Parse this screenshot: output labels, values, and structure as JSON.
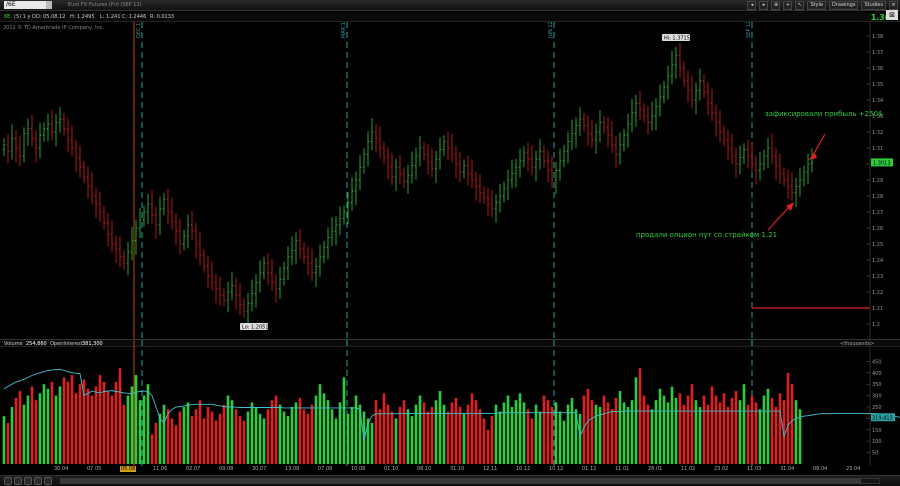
{
  "toolbar": {
    "symbol": "/6E",
    "description": "Euro FX Futures (Fri) (SEP 12)",
    "buttons": [
      "Style",
      "Drawings",
      "Studies"
    ],
    "last_price": "1.301",
    "minmax_icon": "minimize-icon"
  },
  "infobar": {
    "symbol": "6E",
    "period": "(5) 1 y D",
    "date": "D: 05.08.12",
    "high": "H: 1.2495",
    "low": "L: 1.241",
    "close": "C: 1.2446",
    "range": "R: 0.0133"
  },
  "copyright": "2012 © TD Ameritrade IP Company, Inc.",
  "annotations": {
    "profit": "зафиксировали прибыль +250$",
    "sold_put": "продали опцион пут со страйком 1.21"
  },
  "price_labels": {
    "high": "Hi: 1.3715",
    "low": "Lo: 1.2051",
    "current": "1.3013"
  },
  "volume_header": {
    "volume_label": "Volume",
    "volume_value": "254,860",
    "oi_label": "OpenInterest",
    "oi_value": "381,300",
    "units": "<thousands>",
    "oi_current": "319,413"
  },
  "colors": {
    "up": "#2ecc40",
    "down": "#e02020",
    "oi_line": "#40c0d0",
    "divider": "#2aa0a0",
    "strike_line": "#e02020",
    "annotation": "#2ecc40"
  },
  "chart_data": {
    "type": "candlestick",
    "price_axis": {
      "ylim": [
        1.195,
        1.385
      ],
      "ticks": [
        "1.38",
        "1.37",
        "1.36",
        "1.35",
        "1.34",
        "1.33",
        "1.32",
        "1.31",
        "1.3",
        "1.29",
        "1.28",
        "1.27",
        "1.26",
        "1.25",
        "1.24",
        "1.23",
        "1.22",
        "1.21",
        "1.2"
      ]
    },
    "volume_axis": {
      "ylim": [
        0,
        500
      ],
      "ticks": [
        "450",
        "400",
        "350",
        "300",
        "250",
        "200",
        "150",
        "100",
        "50"
      ]
    },
    "period_labels": [
      "DEC 11",
      "MAR 12",
      "JUN 12",
      "SEP 12"
    ],
    "strike_level": 1.21,
    "time_labels": [
      "30.04",
      "07.05",
      "05.08",
      "11.06",
      "02.07",
      "09.08",
      "30.07",
      "13.08",
      "07.08",
      "10.08",
      "01.10",
      "08.10",
      "31.10",
      "12.11",
      "10.12",
      "10.12",
      "01.12",
      "11.01",
      "28.01",
      "11.02",
      "23.02",
      "11.03",
      "31.04",
      "08.04",
      "23.04"
    ],
    "highlighted_time_label": "05.08",
    "closes": [
      1.312,
      1.308,
      1.316,
      1.31,
      1.305,
      1.319,
      1.322,
      1.316,
      1.31,
      1.318,
      1.322,
      1.325,
      1.32,
      1.326,
      1.328,
      1.322,
      1.315,
      1.31,
      1.304,
      1.298,
      1.292,
      1.286,
      1.28,
      1.275,
      1.27,
      1.263,
      1.256,
      1.25,
      1.247,
      1.242,
      1.238,
      1.245,
      1.252,
      1.26,
      1.265,
      1.27,
      1.275,
      1.268,
      1.262,
      1.272,
      1.278,
      1.27,
      1.264,
      1.258,
      1.25,
      1.255,
      1.262,
      1.258,
      1.25,
      1.243,
      1.236,
      1.23,
      1.226,
      1.222,
      1.218,
      1.215,
      1.22,
      1.224,
      1.218,
      1.212,
      1.208,
      1.213,
      1.219,
      1.226,
      1.232,
      1.238,
      1.232,
      1.226,
      1.222,
      1.228,
      1.235,
      1.242,
      1.246,
      1.252,
      1.247,
      1.242,
      1.238,
      1.232,
      1.236,
      1.242,
      1.248,
      1.254,
      1.258,
      1.262,
      1.266,
      1.27,
      1.276,
      1.283,
      1.29,
      1.298,
      1.306,
      1.314,
      1.32,
      1.316,
      1.31,
      1.304,
      1.298,
      1.292,
      1.298,
      1.294,
      1.289,
      1.293,
      1.299,
      1.305,
      1.31,
      1.306,
      1.301,
      1.297,
      1.303,
      1.309,
      1.314,
      1.31,
      1.306,
      1.3,
      1.295,
      1.299,
      1.294,
      1.29,
      1.286,
      1.282,
      1.279,
      1.275,
      1.272,
      1.276,
      1.28,
      1.285,
      1.29,
      1.294,
      1.298,
      1.302,
      1.307,
      1.303,
      1.298,
      1.303,
      1.308,
      1.302,
      1.296,
      1.29,
      1.296,
      1.302,
      1.308,
      1.314,
      1.319,
      1.324,
      1.328,
      1.324,
      1.319,
      1.315,
      1.32,
      1.326,
      1.323,
      1.318,
      1.312,
      1.306,
      1.312,
      1.318,
      1.325,
      1.332,
      1.338,
      1.334,
      1.33,
      1.326,
      1.33,
      1.336,
      1.342,
      1.348,
      1.355,
      1.362,
      1.368,
      1.36,
      1.352,
      1.346,
      1.34,
      1.346,
      1.352,
      1.345,
      1.338,
      1.332,
      1.326,
      1.32,
      1.315,
      1.31,
      1.305,
      1.3,
      1.304,
      1.309,
      1.305,
      1.3,
      1.296,
      1.3,
      1.305,
      1.31,
      1.305,
      1.299,
      1.294,
      1.29,
      1.286,
      1.282,
      1.286,
      1.29,
      1.295,
      1.3,
      1.301
    ],
    "volumes": [
      210,
      180,
      250,
      290,
      320,
      260,
      300,
      340,
      280,
      310,
      350,
      330,
      360,
      300,
      340,
      380,
      360,
      390,
      310,
      350,
      370,
      330,
      300,
      340,
      390,
      360,
      320,
      300,
      360,
      420,
      260,
      300,
      340,
      390,
      280,
      300,
      350,
      130,
      180,
      220,
      260,
      240,
      200,
      170,
      230,
      250,
      270,
      210,
      240,
      280,
      200,
      250,
      230,
      190,
      220,
      260,
      300,
      280,
      240,
      210,
      190,
      230,
      270,
      250,
      220,
      200,
      240,
      280,
      300,
      260,
      230,
      210,
      250,
      270,
      290,
      240,
      220,
      260,
      300,
      350,
      310,
      280,
      240,
      200,
      270,
      380,
      220,
      250,
      300,
      260,
      230,
      200,
      180,
      280,
      240,
      310,
      260,
      230,
      200,
      250,
      280,
      240,
      210,
      260,
      300,
      270,
      230,
      250,
      280,
      320,
      260,
      230,
      270,
      290,
      250,
      220,
      260,
      310,
      280,
      240,
      200,
      150,
      210,
      260,
      230,
      270,
      300,
      250,
      280,
      310,
      270,
      240,
      200,
      260,
      230,
      300,
      280,
      250,
      270,
      230,
      190,
      260,
      290,
      240,
      220,
      300,
      330,
      280,
      260,
      250,
      300,
      270,
      240,
      290,
      320,
      270,
      250,
      280,
      380,
      420,
      300,
      260,
      240,
      280,
      330,
      300,
      270,
      340,
      290,
      310,
      260,
      300,
      350,
      280,
      250,
      300,
      260,
      340,
      300,
      270,
      310,
      250,
      290,
      320,
      280,
      350,
      260,
      300,
      270,
      240,
      300,
      330,
      290,
      250,
      310,
      280,
      400,
      350,
      280,
      240
    ],
    "open_interest": [
      330,
      340,
      350,
      360,
      365,
      372,
      380,
      388,
      395,
      400,
      405,
      410,
      412,
      414,
      416,
      410,
      405,
      400,
      398,
      396,
      300,
      310,
      320,
      315,
      312,
      318,
      320,
      322,
      318,
      316,
      312,
      310,
      308,
      315,
      318,
      320,
      316,
      300,
      250,
      200,
      180,
      220,
      240,
      250,
      252,
      255,
      258,
      260,
      262,
      262,
      262,
      262,
      262,
      258,
      255,
      252,
      250,
      250,
      249,
      248,
      248,
      248,
      248,
      248,
      248,
      248,
      248,
      248,
      248,
      248,
      246,
      246,
      246,
      246,
      246,
      246,
      246,
      246,
      246,
      246,
      246,
      246,
      246,
      246,
      246,
      246,
      246,
      246,
      246,
      240,
      100,
      180,
      210,
      220,
      220,
      220,
      220,
      220,
      220,
      222,
      222,
      222,
      222,
      222,
      222,
      222,
      222,
      222,
      222,
      222,
      222,
      222,
      222,
      222,
      222,
      222,
      222,
      222,
      222,
      222,
      222,
      222,
      222,
      222,
      225,
      225,
      225,
      225,
      225,
      225,
      225,
      225,
      225,
      225,
      225,
      225,
      225,
      225,
      225,
      225,
      225,
      225,
      225,
      225,
      120,
      160,
      190,
      200,
      210,
      215,
      220,
      225,
      230,
      230,
      230,
      232,
      232,
      232,
      232,
      232,
      232,
      232,
      232,
      232,
      232,
      232,
      232,
      232,
      232,
      232,
      232,
      232,
      232,
      232,
      232,
      232,
      232,
      232,
      232,
      232,
      232,
      232,
      232,
      232,
      232,
      232,
      232,
      232,
      232,
      232,
      232,
      232,
      232,
      232,
      232,
      120,
      170,
      190,
      200,
      205,
      210,
      212,
      215,
      218,
      220,
      222,
      222,
      222,
      222,
      222,
      222,
      222,
      222,
      222,
      222,
      222,
      222,
      222,
      222,
      218,
      215,
      212,
      210,
      208,
      205
    ]
  }
}
